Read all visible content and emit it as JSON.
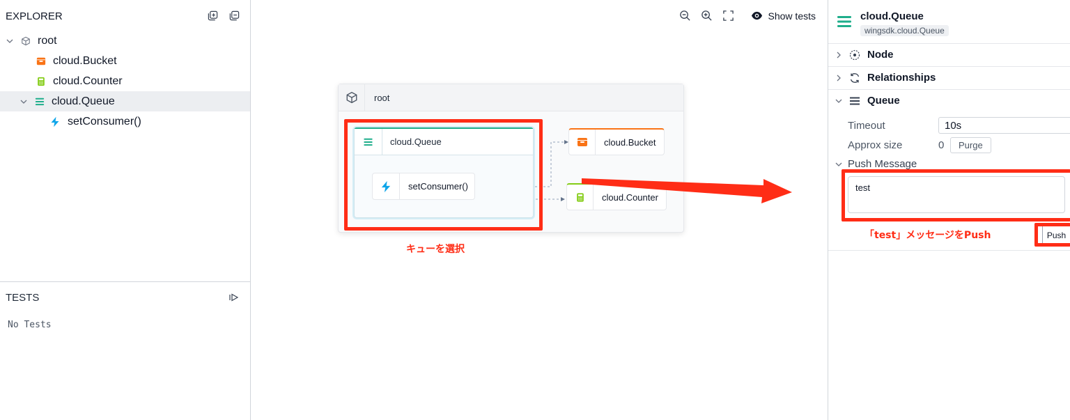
{
  "explorer": {
    "title": "EXPLORER",
    "tree": [
      {
        "label": "root",
        "icon": "cube-icon"
      },
      {
        "label": "cloud.Bucket",
        "icon": "bucket-icon"
      },
      {
        "label": "cloud.Counter",
        "icon": "counter-icon"
      },
      {
        "label": "cloud.Queue",
        "icon": "queue-icon"
      },
      {
        "label": "setConsumer()",
        "icon": "lightning-icon"
      }
    ]
  },
  "tests": {
    "title": "TESTS",
    "empty": "No Tests"
  },
  "toolbar": {
    "show_tests": "Show tests"
  },
  "graph": {
    "root_label": "root",
    "queue_label": "cloud.Queue",
    "consumer_label": "setConsumer()",
    "bucket_label": "cloud.Bucket",
    "counter_label": "cloud.Counter"
  },
  "annotations": {
    "select_queue": "キューを選択",
    "push_test": "「test」メッセージをPush"
  },
  "inspector": {
    "title": "cloud.Queue",
    "subtitle": "wingsdk.cloud.Queue",
    "sections": {
      "node": "Node",
      "relationships": "Relationships",
      "queue": "Queue"
    },
    "timeout_label": "Timeout",
    "timeout_value": "10s",
    "approx_label": "Approx size",
    "approx_value": "0",
    "purge_label": "Purge",
    "push_message_label": "Push Message",
    "message_value": "test",
    "push_label": "Push"
  },
  "colors": {
    "accent_red": "#ff2d16",
    "queue_green": "#1fae8b",
    "bucket_orange": "#f97316",
    "counter_lime": "#84cc16",
    "function_blue": "#0ea5e9"
  }
}
